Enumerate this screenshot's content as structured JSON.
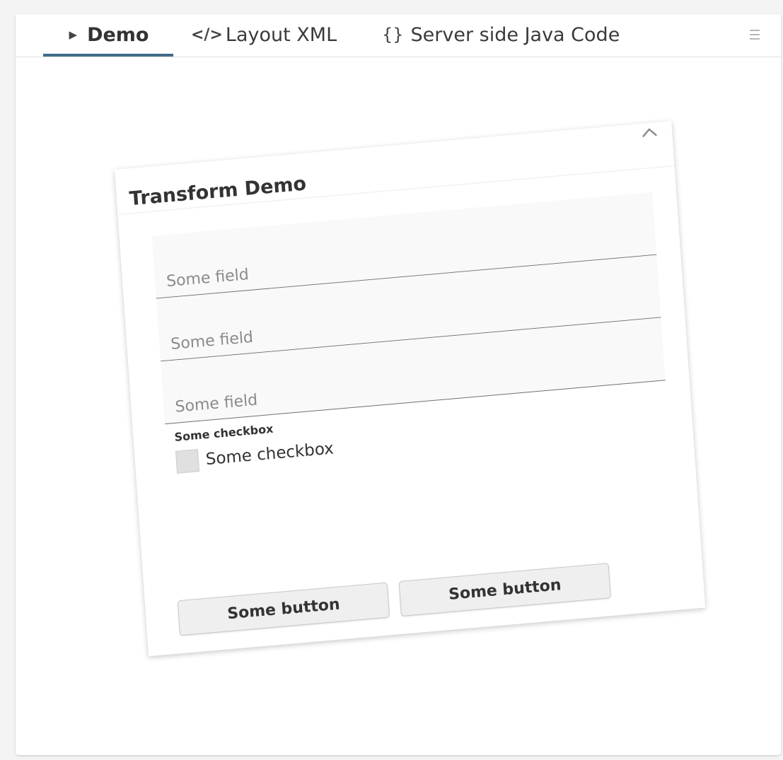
{
  "tabs": {
    "demo": {
      "icon": "▶",
      "label": "Demo"
    },
    "layout_xml": {
      "icon": "</>",
      "label": "Layout XML"
    },
    "java_code": {
      "icon": "{}",
      "label": "Server side Java Code"
    }
  },
  "menu": {
    "icon": "menu-icon"
  },
  "card": {
    "title": "Transform Demo",
    "collapse_icon": "chevron-up-icon",
    "fields": [
      {
        "placeholder": "Some field",
        "value": ""
      },
      {
        "placeholder": "Some field",
        "value": ""
      },
      {
        "placeholder": "Some field",
        "value": ""
      }
    ],
    "checkbox_group_label": "Some checkbox",
    "checkbox_label": "Some checkbox",
    "checkbox_checked": false,
    "buttons": [
      "Some button",
      "Some button"
    ]
  },
  "colors": {
    "tab_accent": "#3f6c88",
    "field_underline": "#707070"
  }
}
